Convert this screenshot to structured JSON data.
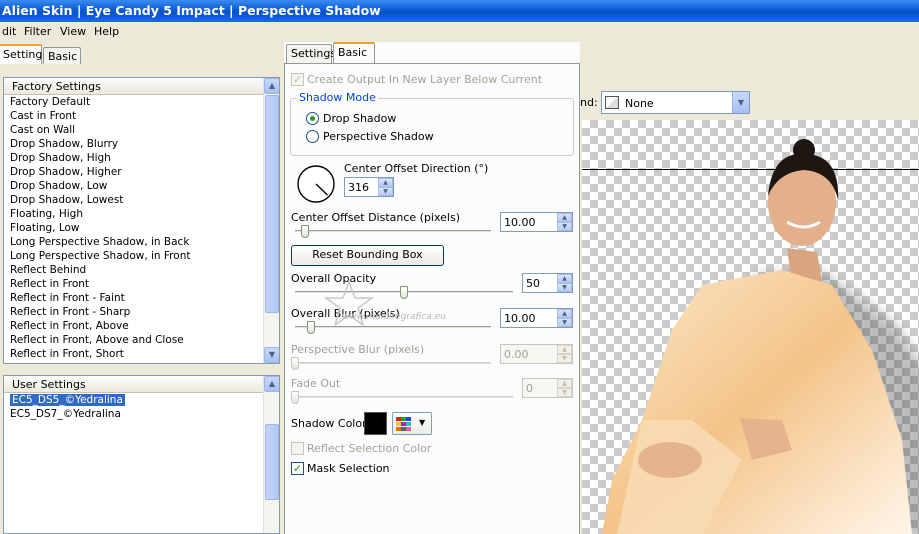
{
  "window": {
    "title": "Alien Skin  |  Eye Candy 5 Impact  |  Perspective Shadow"
  },
  "menu": [
    "dit",
    "Filter",
    "View",
    "Help"
  ],
  "left_tabs": {
    "settings": "Settings",
    "basic": "Basic"
  },
  "factory_settings": {
    "header": "Factory Settings",
    "items": [
      "Factory Default",
      "Cast in Front",
      "Cast on Wall",
      "Drop Shadow, Blurry",
      "Drop Shadow, High",
      "Drop Shadow, Higher",
      "Drop Shadow, Low",
      "Drop Shadow, Lowest",
      "Floating, High",
      "Floating, Low",
      "Long Perspective Shadow, in Back",
      "Long Perspective Shadow, in Front",
      "Reflect Behind",
      "Reflect in Front",
      "Reflect in Front - Faint",
      "Reflect in Front - Sharp",
      "Reflect in Front, Above",
      "Reflect in Front, Above and Close",
      "Reflect in Front, Short"
    ]
  },
  "user_settings": {
    "header": "User Settings",
    "items": [
      "EC5_DS5_©Yedralina",
      "EC5_DS7_©Yedralina"
    ],
    "selected_index": 0
  },
  "mid_tabs": {
    "settings": "Settings",
    "basic": "Basic"
  },
  "basic": {
    "create_output_label": "Create Output In New Layer Below Current",
    "create_output_checked": true,
    "shadow_mode": {
      "title": "Shadow Mode",
      "options": [
        "Drop Shadow",
        "Perspective Shadow"
      ],
      "selected_index": 0
    },
    "center_offset_direction": {
      "label": "Center Offset Direction (°)",
      "value": "316",
      "degrees": 316
    },
    "center_offset_distance": {
      "label": "Center Offset Distance (pixels)",
      "value": "10.00",
      "level": 0.05
    },
    "reset_button": "Reset Bounding Box",
    "overall_opacity": {
      "label": "Overall Opacity",
      "value": "50",
      "level": 0.5
    },
    "overall_blur": {
      "label": "Overall Blur (pixels)",
      "value": "10.00",
      "level": 0.08
    },
    "perspective_blur": {
      "label": "Perspective Blur (pixels)",
      "value": "0.00",
      "level": 0.0
    },
    "fade_out": {
      "label": "Fade Out",
      "value": "0",
      "level": 0.0
    },
    "shadow_color": {
      "label": "Shadow Color",
      "color": "#000000"
    },
    "reflect_selection_label": "Reflect Selection Color",
    "reflect_selection_checked": false,
    "mask_selection_label": "Mask Selection",
    "mask_selection_checked": true
  },
  "watermark": "www.maidiregrafica.eu",
  "preview": {
    "background_label": "nd:",
    "background_value": "None"
  },
  "colors": {
    "title_bar": "#0a5bd8",
    "selection": "#316ac5",
    "group_title": "#0046d5"
  }
}
